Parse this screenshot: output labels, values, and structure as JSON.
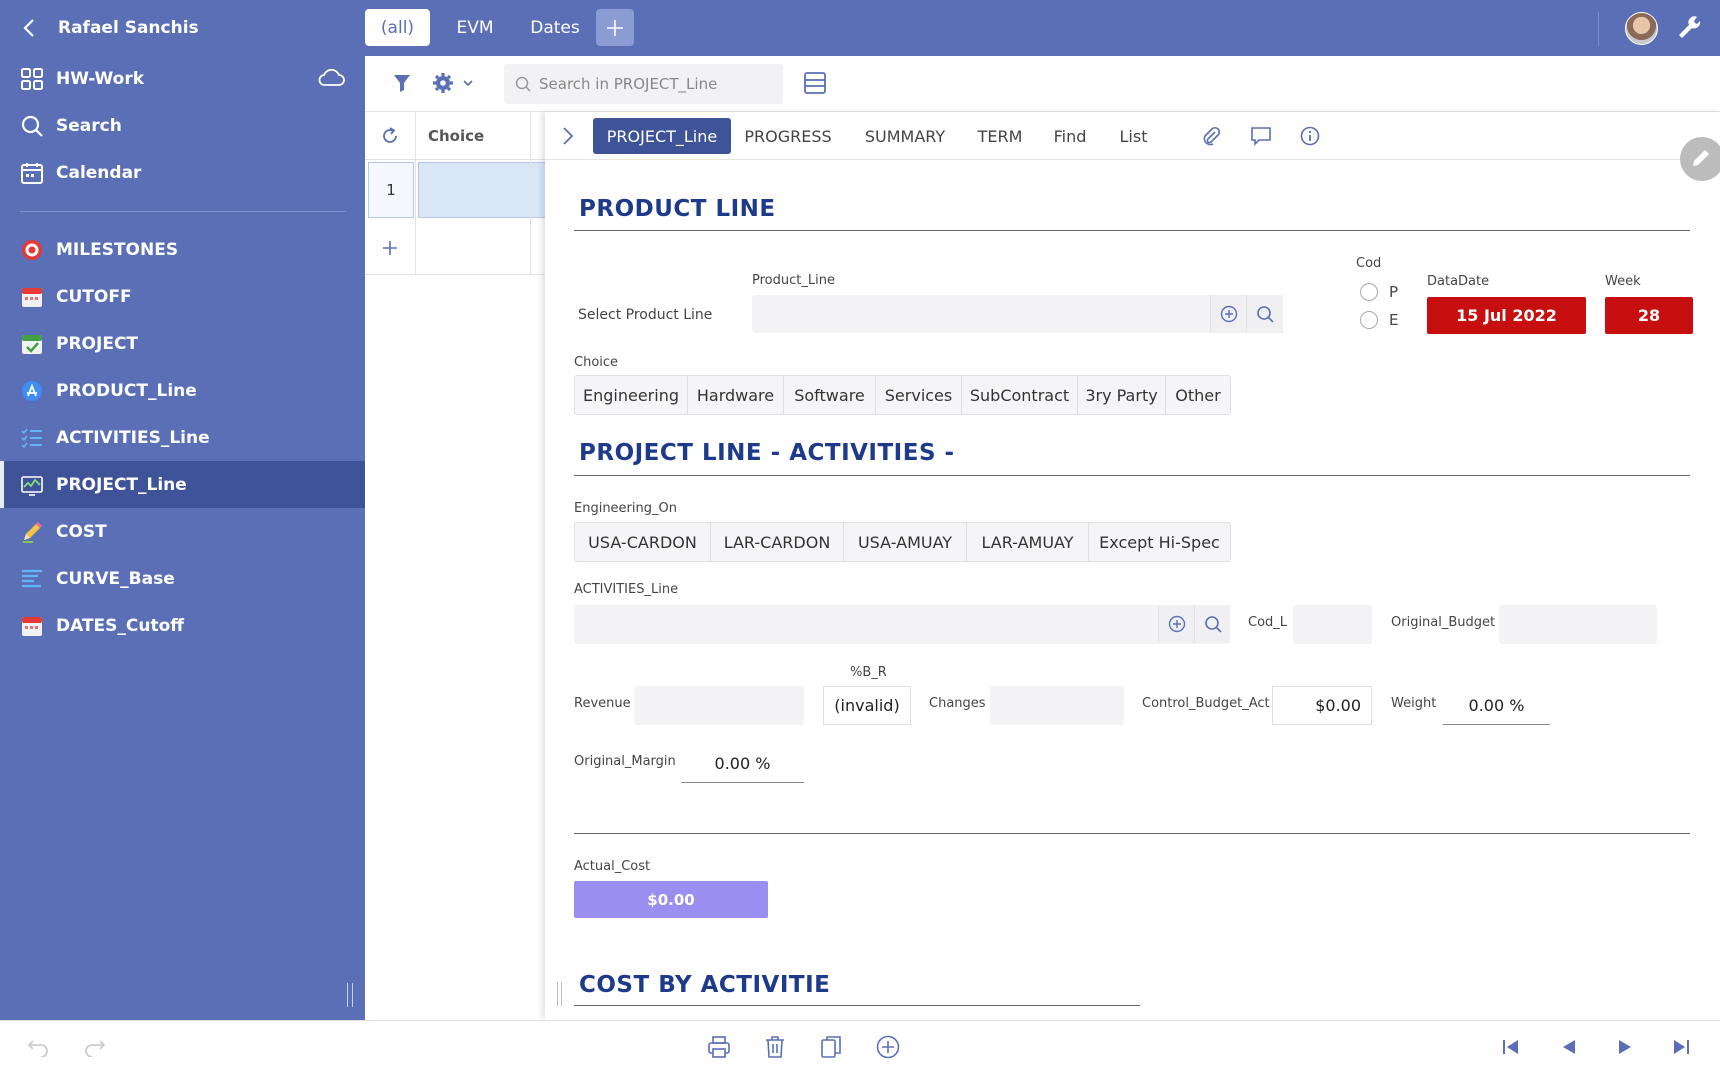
{
  "sidebar": {
    "user": "Rafael Sanchis",
    "top_items": [
      {
        "label": "HW-Work"
      },
      {
        "label": "Search"
      },
      {
        "label": "Calendar"
      }
    ],
    "tables": [
      {
        "label": "MILESTONES"
      },
      {
        "label": "CUTOFF"
      },
      {
        "label": "PROJECT"
      },
      {
        "label": "PRODUCT_Line"
      },
      {
        "label": "ACTIVITIES_Line"
      },
      {
        "label": "PROJECT_Line"
      },
      {
        "label": "COST"
      },
      {
        "label": "CURVE_Base"
      },
      {
        "label": "DATES_Cutoff"
      }
    ]
  },
  "topbar": {
    "tabs": [
      "(all)",
      "EVM",
      "Dates"
    ]
  },
  "toolbar": {
    "search_placeholder": "Search in PROJECT_Line"
  },
  "list": {
    "column_header": "Choice",
    "rows": [
      {
        "num": "1"
      }
    ]
  },
  "detail": {
    "tabs": [
      "PROJECT_Line",
      "PROGRESS",
      "SUMMARY",
      "TERM",
      "Find",
      "List"
    ],
    "product_line": {
      "title": "PRODUCT LINE",
      "select_label": "Select Product Line",
      "field_label": "Product_Line",
      "cod_label": "Cod",
      "cod_options": [
        "P",
        "E"
      ],
      "datadate_label": "DataDate",
      "datadate_value": "15 Jul 2022",
      "week_label": "Week",
      "week_value": "28",
      "choice_label": "Choice",
      "choices": [
        "Engineering",
        "Hardware",
        "Software",
        "Services",
        "SubContract",
        "3ry Party",
        "Other"
      ]
    },
    "project_line": {
      "title": "PROJECT LINE  - ACTIVITIES -",
      "eng_label": "Engineering_On",
      "eng_options": [
        "USA-CARDON",
        "LAR-CARDON",
        "USA-AMUAY",
        "LAR-AMUAY",
        "Except Hi-Spec"
      ],
      "activities_label": "ACTIVITIES_Line",
      "cod_l_label": "Cod_L",
      "orig_budget_label": "Original_Budget",
      "revenue_label": "Revenue",
      "br_label": "%B_R",
      "br_value": "(invalid)",
      "changes_label": "Changes",
      "control_budget_label": "Control_Budget_Act",
      "control_budget_value": "$0.00",
      "weight_label": "Weight",
      "weight_value": "0.00 %",
      "orig_margin_label": "Original_Margin",
      "orig_margin_value": "0.00 %",
      "actual_cost_label": "Actual_Cost",
      "actual_cost_value": "$0.00"
    },
    "cost": {
      "title": "COST BY ACTIVITIE"
    }
  },
  "colors": {
    "sidebar_bg": "#5a6fb5",
    "sidebar_active": "#3f5399",
    "heading": "#1e3a8a",
    "red_badge": "#c80f0f",
    "purple_badge": "#9a8ff0"
  }
}
